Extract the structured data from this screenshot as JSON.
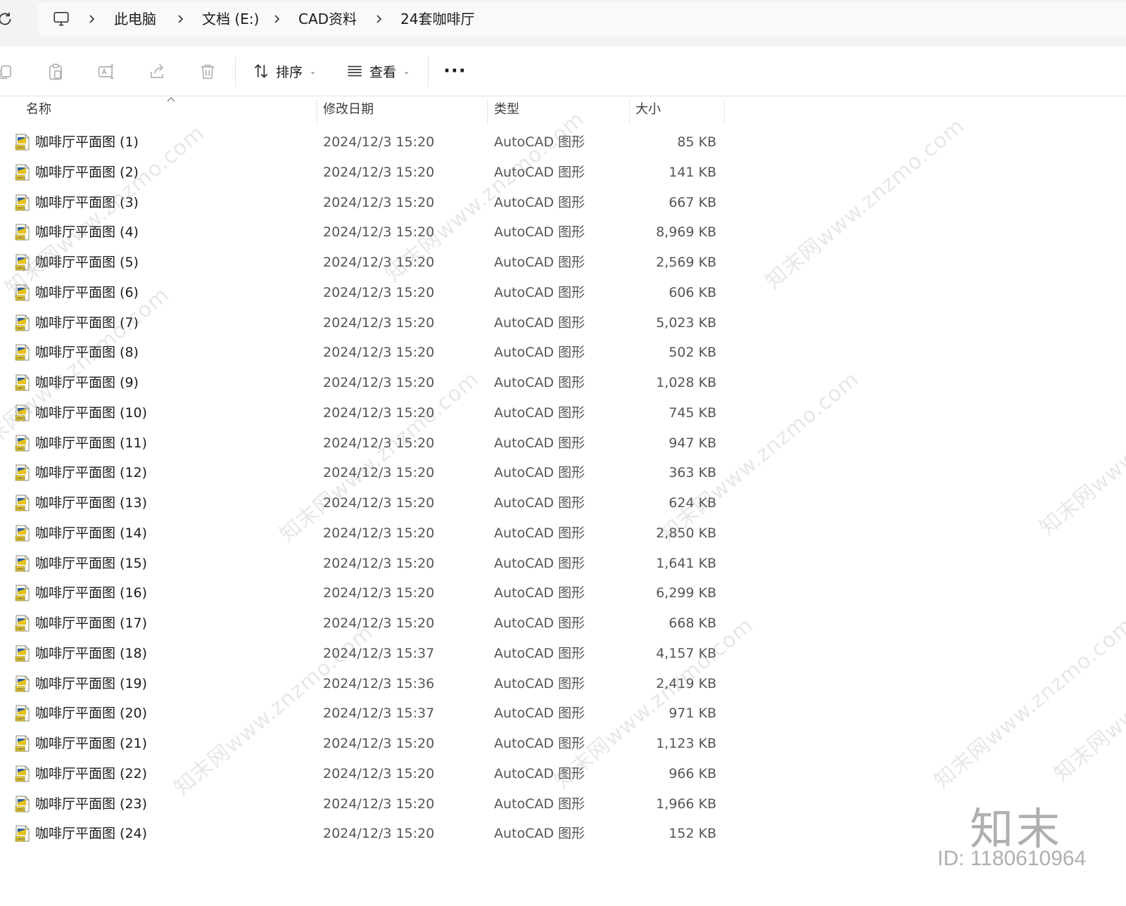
{
  "breadcrumb": {
    "items": [
      "此电脑",
      "文档 (E:)",
      "CAD资料",
      "24套咖啡厅"
    ]
  },
  "toolbar": {
    "sort_label": "排序",
    "view_label": "查看",
    "more_label": "···"
  },
  "columns": {
    "name": "名称",
    "date": "修改日期",
    "type": "类型",
    "size": "大小"
  },
  "files": [
    {
      "name": "咖啡厅平面图 (1)",
      "date": "2024/12/3 15:20",
      "type": "AutoCAD 图形",
      "size": "85 KB"
    },
    {
      "name": "咖啡厅平面图 (2)",
      "date": "2024/12/3 15:20",
      "type": "AutoCAD 图形",
      "size": "141 KB"
    },
    {
      "name": "咖啡厅平面图 (3)",
      "date": "2024/12/3 15:20",
      "type": "AutoCAD 图形",
      "size": "667 KB"
    },
    {
      "name": "咖啡厅平面图 (4)",
      "date": "2024/12/3 15:20",
      "type": "AutoCAD 图形",
      "size": "8,969 KB"
    },
    {
      "name": "咖啡厅平面图 (5)",
      "date": "2024/12/3 15:20",
      "type": "AutoCAD 图形",
      "size": "2,569 KB"
    },
    {
      "name": "咖啡厅平面图 (6)",
      "date": "2024/12/3 15:20",
      "type": "AutoCAD 图形",
      "size": "606 KB"
    },
    {
      "name": "咖啡厅平面图 (7)",
      "date": "2024/12/3 15:20",
      "type": "AutoCAD 图形",
      "size": "5,023 KB"
    },
    {
      "name": "咖啡厅平面图 (8)",
      "date": "2024/12/3 15:20",
      "type": "AutoCAD 图形",
      "size": "502 KB"
    },
    {
      "name": "咖啡厅平面图 (9)",
      "date": "2024/12/3 15:20",
      "type": "AutoCAD 图形",
      "size": "1,028 KB"
    },
    {
      "name": "咖啡厅平面图 (10)",
      "date": "2024/12/3 15:20",
      "type": "AutoCAD 图形",
      "size": "745 KB"
    },
    {
      "name": "咖啡厅平面图 (11)",
      "date": "2024/12/3 15:20",
      "type": "AutoCAD 图形",
      "size": "947 KB"
    },
    {
      "name": "咖啡厅平面图 (12)",
      "date": "2024/12/3 15:20",
      "type": "AutoCAD 图形",
      "size": "363 KB"
    },
    {
      "name": "咖啡厅平面图 (13)",
      "date": "2024/12/3 15:20",
      "type": "AutoCAD 图形",
      "size": "624 KB"
    },
    {
      "name": "咖啡厅平面图 (14)",
      "date": "2024/12/3 15:20",
      "type": "AutoCAD 图形",
      "size": "2,850 KB"
    },
    {
      "name": "咖啡厅平面图 (15)",
      "date": "2024/12/3 15:20",
      "type": "AutoCAD 图形",
      "size": "1,641 KB"
    },
    {
      "name": "咖啡厅平面图 (16)",
      "date": "2024/12/3 15:20",
      "type": "AutoCAD 图形",
      "size": "6,299 KB"
    },
    {
      "name": "咖啡厅平面图 (17)",
      "date": "2024/12/3 15:20",
      "type": "AutoCAD 图形",
      "size": "668 KB"
    },
    {
      "name": "咖啡厅平面图 (18)",
      "date": "2024/12/3 15:37",
      "type": "AutoCAD 图形",
      "size": "4,157 KB"
    },
    {
      "name": "咖啡厅平面图 (19)",
      "date": "2024/12/3 15:36",
      "type": "AutoCAD 图形",
      "size": "2,419 KB"
    },
    {
      "name": "咖啡厅平面图 (20)",
      "date": "2024/12/3 15:37",
      "type": "AutoCAD 图形",
      "size": "971 KB"
    },
    {
      "name": "咖啡厅平面图 (21)",
      "date": "2024/12/3 15:20",
      "type": "AutoCAD 图形",
      "size": "1,123 KB"
    },
    {
      "name": "咖啡厅平面图 (22)",
      "date": "2024/12/3 15:20",
      "type": "AutoCAD 图形",
      "size": "966 KB"
    },
    {
      "name": "咖啡厅平面图 (23)",
      "date": "2024/12/3 15:20",
      "type": "AutoCAD 图形",
      "size": "1,966 KB"
    },
    {
      "name": "咖啡厅平面图 (24)",
      "date": "2024/12/3 15:20",
      "type": "AutoCAD 图形",
      "size": "152 KB"
    }
  ],
  "watermark": {
    "text": "知末网www.znzmo.com",
    "brand": "知末",
    "id_text": "ID: 1180610964"
  },
  "icons": {
    "refresh": "refresh-icon",
    "pc": "computer-icon",
    "copy": "copy-icon",
    "paste": "paste-icon",
    "rename": "rename-icon",
    "share": "share-icon",
    "delete": "delete-icon",
    "sort": "sort-icon",
    "view": "view-icon",
    "file": "dwg-file-icon"
  }
}
